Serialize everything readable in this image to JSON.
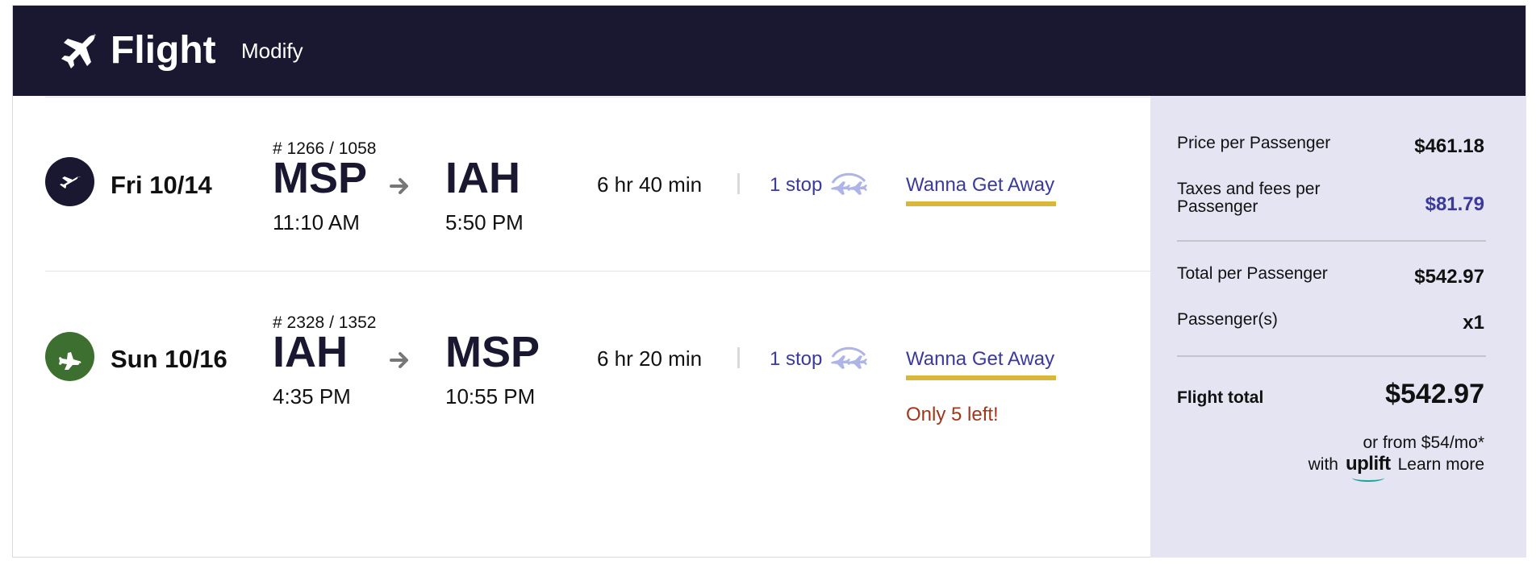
{
  "header": {
    "title": "Flight",
    "modify_label": "Modify"
  },
  "flights": [
    {
      "direction": "outbound",
      "circle_color": "#1a1731",
      "date": "Fri 10/14",
      "flight_number": "# 1266 / 1058",
      "origin": "MSP",
      "depart_time": "11:10 AM",
      "destination": "IAH",
      "arrive_time": "5:50 PM",
      "duration": "6 hr 40 min",
      "stops": "1 stop",
      "fare_type": "Wanna Get Away",
      "seats_left": ""
    },
    {
      "direction": "return",
      "circle_color": "#3d7030",
      "date": "Sun 10/16",
      "flight_number": "# 2328 / 1352",
      "origin": "IAH",
      "depart_time": "4:35 PM",
      "destination": "MSP",
      "arrive_time": "10:55 PM",
      "duration": "6 hr 20 min",
      "stops": "1 stop",
      "fare_type": "Wanna Get Away",
      "seats_left": "Only 5 left!"
    }
  ],
  "summary": {
    "price_per_passenger_label": "Price per Passenger",
    "price_per_passenger_value": "$461.18",
    "taxes_label_line1": "Taxes and fees per",
    "taxes_label_line2": "Passenger",
    "taxes_value": "$81.79",
    "total_per_passenger_label": "Total per Passenger",
    "total_per_passenger_value": "$542.97",
    "passengers_label": "Passenger(s)",
    "passengers_value": "x1",
    "flight_total_label": "Flight total",
    "flight_total_value": "$542.97",
    "financing_text": "or from $54/mo*",
    "financing_with": "with",
    "uplift_logo": "uplift",
    "learn_more": "Learn more"
  },
  "colors": {
    "header_bg": "#1a1731",
    "accent_purple": "#3b3a9c",
    "fare_bar": "#d8b73a",
    "warning_red": "#a2361b",
    "summary_bg": "#e5e4f2"
  }
}
